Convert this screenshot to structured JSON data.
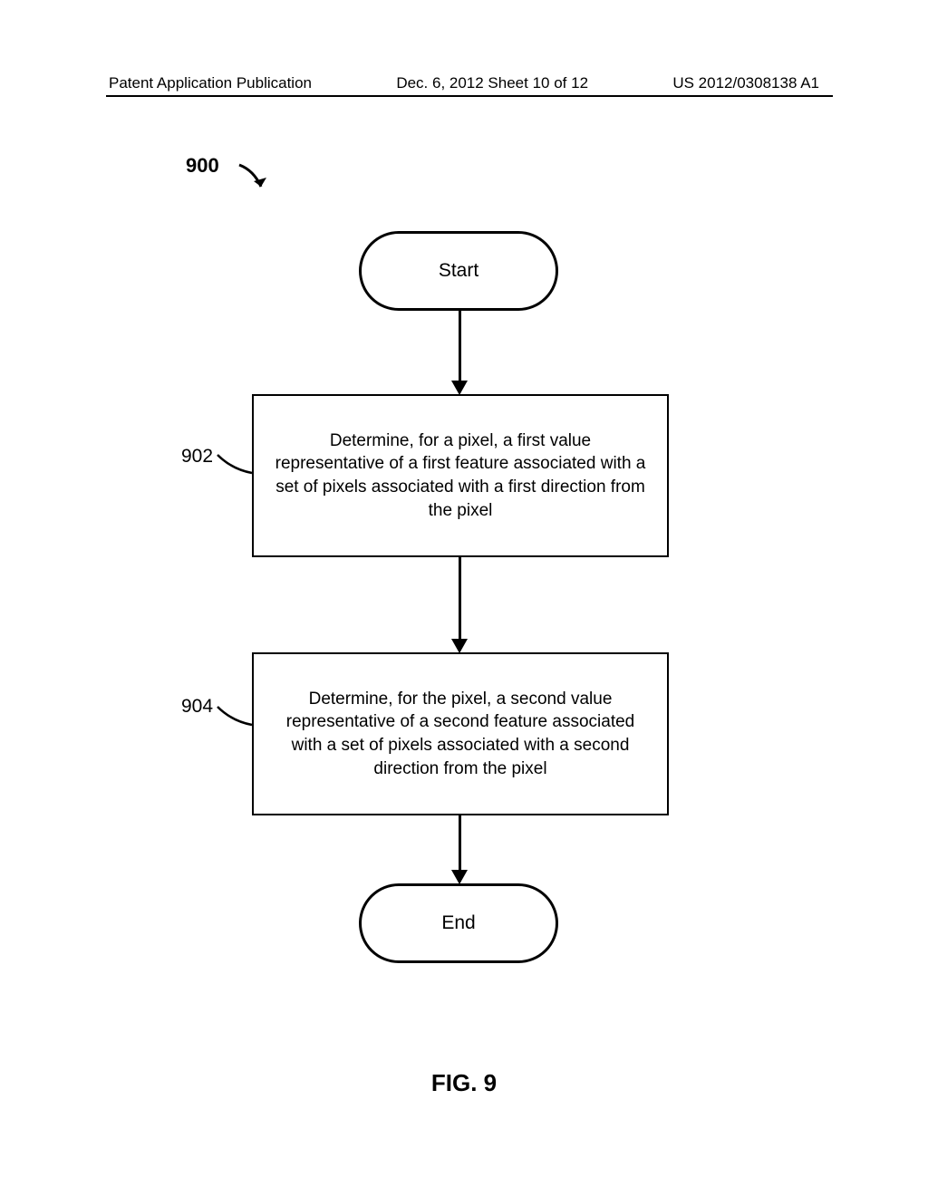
{
  "header": {
    "left": "Patent Application Publication",
    "center": "Dec. 6, 2012   Sheet 10 of 12",
    "right": "US 2012/0308138 A1"
  },
  "flowchart": {
    "ref": "900",
    "start": "Start",
    "end": "End",
    "step902": {
      "ref": "902",
      "text": "Determine, for a pixel, a first value representative of a first feature associated with a set of pixels associated with  a first direction from the pixel"
    },
    "step904": {
      "ref": "904",
      "text": "Determine, for the pixel, a second value representative of a second feature associated with a set of pixels associated with  a second direction from the pixel"
    }
  },
  "figure_label": "FIG. 9"
}
